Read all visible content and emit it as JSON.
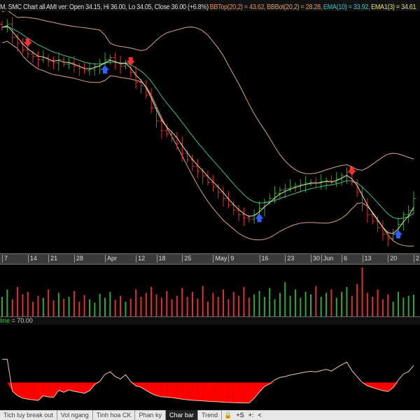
{
  "header": {
    "title": "M. SMC Chart all AMI ver",
    "ohlc": "Open 34.15, Hi 36.00, Lo 34.05, Close 36.00 (+6.8%)",
    "bbtop": "BBTop(20,2) = 43.62,",
    "bbbot": "BBBot(20,2) = 28.28,",
    "ema10": "EMA(10) = 33.92,",
    "ema3": "EMA1(3) = 34.61"
  },
  "colors": {
    "up": "#2faa3a",
    "down": "#e03030",
    "band": "#d9a38a",
    "ema10": "#3fbf8f",
    "ema3": "#e8e0a0",
    "rsi": "#f0c8b0",
    "rsiFill": "#ff0000",
    "buy": "#3060ff",
    "sell": "#ff3030"
  },
  "rsi_label": {
    "prefix": "line",
    "value": "= 70.00"
  },
  "tabs": [
    "Tich luy break out",
    "Vol ngang",
    "Tinh hoa CK",
    "Phan ky",
    "Char bar",
    "Trend"
  ],
  "active_tab": "Char bar",
  "tab_controls": [
    "🔒",
    "+S",
    "+:",
    "<"
  ],
  "chart_data": {
    "type": "candlestick",
    "title": "SMC Chart all AMI ver",
    "close": [
      62.5,
      63,
      61,
      60,
      59,
      58.4,
      58,
      57.5,
      57.8,
      57.2,
      57,
      57.5,
      56.8,
      57,
      56.5,
      56.2,
      55.8,
      56,
      56.5,
      56.8,
      57.5,
      57.8,
      57,
      56.5,
      57,
      55.5,
      54,
      53.5,
      52,
      50,
      48,
      46.5,
      46,
      45.5,
      44.5,
      43,
      42,
      41,
      40.2,
      39.5,
      38.5,
      37.8,
      37,
      36,
      35,
      34.2,
      33.5,
      33,
      32.8,
      33.5,
      34.5,
      35.5,
      36,
      36.8,
      37.3,
      37.5,
      37.8,
      38,
      38.2,
      38.4,
      38.5,
      38.4,
      38.6,
      38.8,
      38.5,
      39,
      39.5,
      40,
      38.5,
      37,
      35,
      33.5,
      32.5,
      31.5,
      30.5,
      29.8,
      30.5,
      32,
      33.5,
      34.15,
      36
    ],
    "volume": [
      40,
      55,
      35,
      60,
      45,
      50,
      30,
      42,
      38,
      55,
      33,
      48,
      36,
      40,
      52,
      30,
      44,
      35,
      28,
      46,
      38,
      50,
      34,
      42,
      30,
      36,
      55,
      40,
      48,
      60,
      45,
      38,
      52,
      35,
      42,
      58,
      40,
      50,
      36,
      62,
      30,
      48,
      40,
      55,
      35,
      50,
      42,
      60,
      38,
      45,
      52,
      40,
      58,
      35,
      48,
      70,
      42,
      55,
      38,
      50,
      45,
      62,
      40,
      48,
      55,
      38,
      50,
      60,
      42,
      66,
      100,
      48,
      40,
      55,
      35,
      45,
      30,
      50,
      38,
      42,
      44
    ],
    "signals": {
      "sell": [
        5,
        25,
        68
      ],
      "buy": [
        20,
        50,
        77
      ]
    },
    "indicators": [
      "BBTop(20,2)",
      "BBBot(20,2)",
      "EMA(10)",
      "EMA1(3)",
      "RSI"
    ],
    "x_ticks": [
      {
        "label": "7",
        "i": 0
      },
      {
        "label": "14",
        "i": 5
      },
      {
        "label": "21",
        "i": 9
      },
      {
        "label": "28",
        "i": 14
      },
      {
        "label": "Apr",
        "i": 20
      },
      {
        "label": "12",
        "i": 26
      },
      {
        "label": "18",
        "i": 30
      },
      {
        "label": "25",
        "i": 35
      },
      {
        "label": "May",
        "i": 41
      },
      {
        "label": "9",
        "i": 44
      },
      {
        "label": "16",
        "i": 50
      },
      {
        "label": "23",
        "i": 55
      },
      {
        "label": "30",
        "i": 60
      },
      {
        "label": "Jun",
        "i": 62
      },
      {
        "label": "6",
        "i": 66
      },
      {
        "label": "13",
        "i": 70
      },
      {
        "label": "20",
        "i": 75
      },
      {
        "label": "2",
        "i": 80
      }
    ],
    "ylim": [
      27.5,
      65
    ],
    "rsi_ylim": [
      0,
      100
    ],
    "rsi_threshold": 30
  }
}
